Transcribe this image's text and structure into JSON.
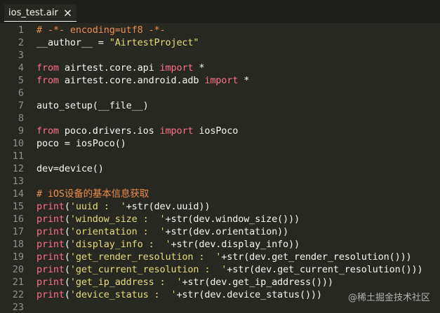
{
  "tab": {
    "label": "ios_test.air",
    "close_icon": "close-icon"
  },
  "colors": {
    "background": "#272822",
    "tabbar": "#1e1f1c",
    "comment": "#f08d49",
    "keyword": "#ff6e86",
    "string": "#e6db74",
    "text": "#f8f8f2",
    "line_number": "#8f908a"
  },
  "editor": {
    "lines": [
      {
        "num": "1",
        "tokens": [
          {
            "t": "comment",
            "v": "# -*- encoding=utf8 -*-"
          }
        ]
      },
      {
        "num": "2",
        "tokens": [
          {
            "t": "id",
            "v": "__author__ = "
          },
          {
            "t": "str",
            "v": "\"AirtestProject\""
          }
        ]
      },
      {
        "num": "3",
        "tokens": []
      },
      {
        "num": "4",
        "tokens": [
          {
            "t": "kw",
            "v": "from"
          },
          {
            "t": "id",
            "v": " airtest.core.api "
          },
          {
            "t": "kw",
            "v": "import"
          },
          {
            "t": "id",
            "v": " *"
          }
        ]
      },
      {
        "num": "5",
        "tokens": [
          {
            "t": "kw",
            "v": "from"
          },
          {
            "t": "id",
            "v": " airtest.core.android.adb "
          },
          {
            "t": "kw",
            "v": "import"
          },
          {
            "t": "id",
            "v": " *"
          }
        ]
      },
      {
        "num": "6",
        "tokens": []
      },
      {
        "num": "7",
        "tokens": [
          {
            "t": "id",
            "v": "auto_setup(__file__)"
          }
        ]
      },
      {
        "num": "8",
        "tokens": []
      },
      {
        "num": "9",
        "tokens": [
          {
            "t": "kw",
            "v": "from"
          },
          {
            "t": "id",
            "v": " poco.drivers.ios "
          },
          {
            "t": "kw",
            "v": "import"
          },
          {
            "t": "id",
            "v": " iosPoco"
          }
        ]
      },
      {
        "num": "10",
        "tokens": [
          {
            "t": "id",
            "v": "poco = iosPoco()"
          }
        ]
      },
      {
        "num": "11",
        "tokens": []
      },
      {
        "num": "12",
        "tokens": [
          {
            "t": "id",
            "v": "dev=device()"
          }
        ]
      },
      {
        "num": "13",
        "tokens": []
      },
      {
        "num": "14",
        "tokens": [
          {
            "t": "comment",
            "v": "# iOS设备的基本信息获取"
          }
        ]
      },
      {
        "num": "15",
        "tokens": [
          {
            "t": "kw",
            "v": "print"
          },
          {
            "t": "id",
            "v": "("
          },
          {
            "t": "str",
            "v": "'uuid :  '"
          },
          {
            "t": "id",
            "v": "+str(dev.uuid))"
          }
        ]
      },
      {
        "num": "16",
        "tokens": [
          {
            "t": "kw",
            "v": "print"
          },
          {
            "t": "id",
            "v": "("
          },
          {
            "t": "str",
            "v": "'window_size :  '"
          },
          {
            "t": "id",
            "v": "+str(dev.window_size()))"
          }
        ]
      },
      {
        "num": "17",
        "tokens": [
          {
            "t": "kw",
            "v": "print"
          },
          {
            "t": "id",
            "v": "("
          },
          {
            "t": "str",
            "v": "'orientation :  '"
          },
          {
            "t": "id",
            "v": "+str(dev.orientation))"
          }
        ]
      },
      {
        "num": "18",
        "tokens": [
          {
            "t": "kw",
            "v": "print"
          },
          {
            "t": "id",
            "v": "("
          },
          {
            "t": "str",
            "v": "'display_info :  '"
          },
          {
            "t": "id",
            "v": "+str(dev.display_info))"
          }
        ]
      },
      {
        "num": "19",
        "tokens": [
          {
            "t": "kw",
            "v": "print"
          },
          {
            "t": "id",
            "v": "("
          },
          {
            "t": "str",
            "v": "'get_render_resolution :  '"
          },
          {
            "t": "id",
            "v": "+str(dev.get_render_resolution()))"
          }
        ]
      },
      {
        "num": "20",
        "tokens": [
          {
            "t": "kw",
            "v": "print"
          },
          {
            "t": "id",
            "v": "("
          },
          {
            "t": "str",
            "v": "'get_current_resolution :  '"
          },
          {
            "t": "id",
            "v": "+str(dev.get_current_resolution()))"
          }
        ]
      },
      {
        "num": "21",
        "tokens": [
          {
            "t": "kw",
            "v": "print"
          },
          {
            "t": "id",
            "v": "("
          },
          {
            "t": "str",
            "v": "'get_ip_address :  '"
          },
          {
            "t": "id",
            "v": "+str(dev.get_ip_address()))"
          }
        ]
      },
      {
        "num": "22",
        "tokens": [
          {
            "t": "kw",
            "v": "print"
          },
          {
            "t": "id",
            "v": "("
          },
          {
            "t": "str",
            "v": "'device_status :  '"
          },
          {
            "t": "id",
            "v": "+str(dev.device_status()))"
          }
        ]
      },
      {
        "num": "23",
        "tokens": []
      }
    ]
  },
  "watermark": "@稀土掘金技术社区"
}
